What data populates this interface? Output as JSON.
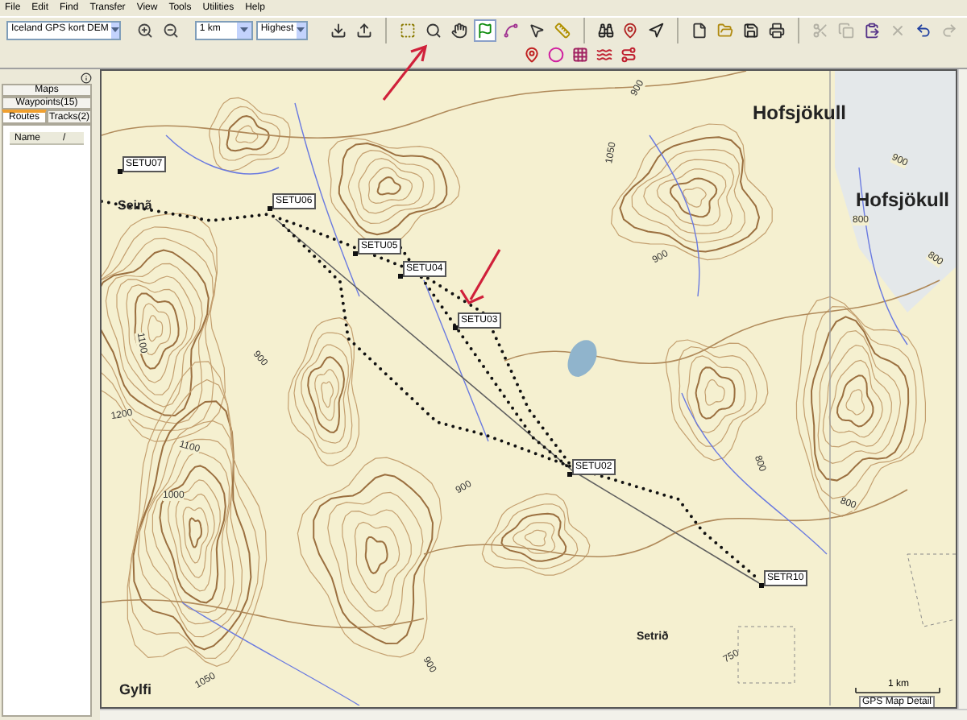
{
  "menu": [
    "File",
    "Edit",
    "Find",
    "Transfer",
    "View",
    "Tools",
    "Utilities",
    "Help"
  ],
  "toolbar": {
    "map_product": "Iceland GPS kort DEM",
    "zoom": "1 km",
    "detail": "Highest",
    "tools": [
      {
        "kind": "zoomin",
        "disabled": false,
        "selected": false
      },
      {
        "kind": "zoomout",
        "disabled": false,
        "selected": false
      },
      {
        "kind": "gap"
      },
      {
        "kind": "receive",
        "disabled": false,
        "selected": false
      },
      {
        "kind": "send",
        "disabled": false,
        "selected": false
      },
      {
        "kind": "sep"
      },
      {
        "kind": "mapselect",
        "disabled": false,
        "selected": false
      },
      {
        "kind": "zoomtool",
        "disabled": false,
        "selected": false
      },
      {
        "kind": "hand",
        "disabled": false,
        "selected": false
      },
      {
        "kind": "flag",
        "disabled": false,
        "selected": true
      },
      {
        "kind": "route",
        "disabled": false,
        "selected": false
      },
      {
        "kind": "pointer",
        "disabled": false,
        "selected": false
      },
      {
        "kind": "ruler",
        "disabled": false,
        "selected": false
      },
      {
        "kind": "sep"
      },
      {
        "kind": "find",
        "disabled": false,
        "selected": false
      },
      {
        "kind": "findnear",
        "disabled": false,
        "selected": false
      },
      {
        "kind": "findplace",
        "disabled": false,
        "selected": false
      },
      {
        "kind": "sep"
      },
      {
        "kind": "new",
        "disabled": false,
        "selected": false
      },
      {
        "kind": "open",
        "disabled": false,
        "selected": false
      },
      {
        "kind": "save",
        "disabled": false,
        "selected": false
      },
      {
        "kind": "print",
        "disabled": false,
        "selected": false
      },
      {
        "kind": "sep"
      },
      {
        "kind": "cut",
        "disabled": true,
        "selected": false
      },
      {
        "kind": "copy",
        "disabled": true,
        "selected": false
      },
      {
        "kind": "paste",
        "disabled": false,
        "selected": false
      },
      {
        "kind": "delete",
        "disabled": true,
        "selected": false
      },
      {
        "kind": "undo",
        "disabled": false,
        "selected": false
      },
      {
        "kind": "redo",
        "disabled": true,
        "selected": false
      }
    ],
    "tools_row2": [
      {
        "kind": "properties",
        "disabled": false
      },
      {
        "kind": "area",
        "disabled": false
      },
      {
        "kind": "grid",
        "disabled": false
      },
      {
        "kind": "wave",
        "disabled": false
      },
      {
        "kind": "trackroute",
        "disabled": false
      }
    ]
  },
  "sidebar": {
    "tabs": [
      {
        "label": "Maps",
        "selected": false
      },
      {
        "label": "Waypoints(15)",
        "selected": false
      },
      {
        "label": "Routes",
        "selected": true
      },
      {
        "label": "Tracks(2)",
        "selected": false
      }
    ],
    "list_columns": [
      "Name",
      "/"
    ]
  },
  "map": {
    "waypoints": [
      {
        "label": "SETU07"
      },
      {
        "label": "SETU06"
      },
      {
        "label": "SETU05"
      },
      {
        "label": "SETU04"
      },
      {
        "label": "SETU03"
      },
      {
        "label": "SETU02"
      },
      {
        "label": "SETR10"
      }
    ],
    "place_names": [
      "Hofsjökull",
      "Hofsjökull",
      "Seinã",
      "Gylfi",
      "Setrið"
    ],
    "contour_labels": [
      "900",
      "1050",
      "900",
      "800",
      "800",
      "900",
      "1100",
      "900",
      "1200",
      "1100",
      "1000",
      "900",
      "800",
      "800",
      "1050",
      "900",
      "750"
    ],
    "scale": "1 km",
    "detail_label": "GPS Map Detail"
  }
}
